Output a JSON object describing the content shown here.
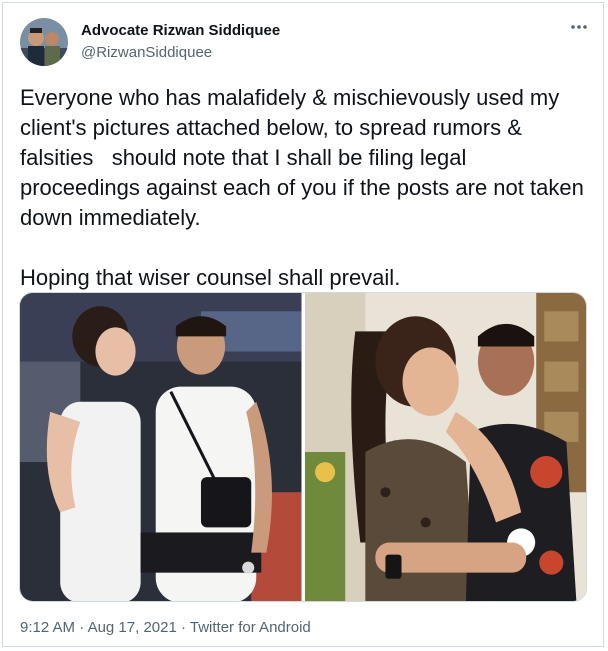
{
  "author": {
    "name": "Advocate Rizwan Siddiquee",
    "handle": "@RizwanSiddiquee"
  },
  "tweet": {
    "text": "Everyone who has malafidely & mischievously used my client's pictures attached below, to spread rumors & falsities   should note that I shall be filing legal proceedings against each of you if the posts are not taken down immediately.\n\nHoping that wiser counsel shall prevail."
  },
  "media": {
    "photos": [
      {
        "icon": "photo-left"
      },
      {
        "icon": "photo-right"
      }
    ]
  },
  "meta": {
    "time": "9:12 AM",
    "separator": " · ",
    "date": "Aug 17, 2021",
    "source": "Twitter for Android"
  },
  "icons": {
    "more": "more-horizontal-icon"
  },
  "colors": {
    "text": "#0f1419",
    "secondary": "#536471",
    "border": "#cfd9de"
  }
}
